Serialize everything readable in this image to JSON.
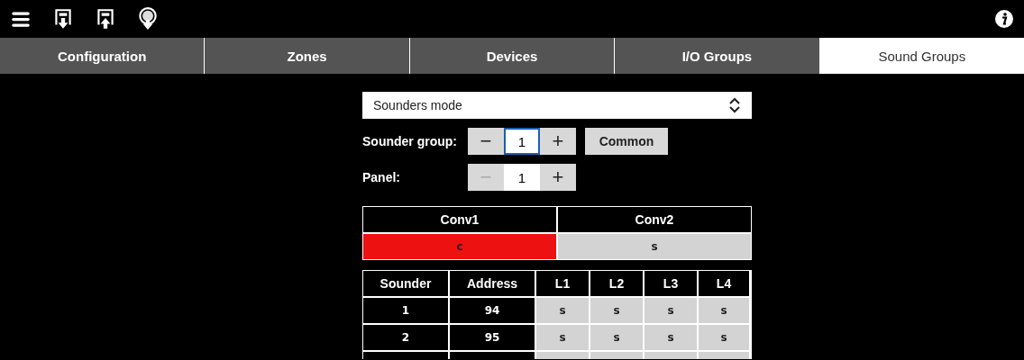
{
  "stepper_symbols": {
    "minus": "−",
    "plus": "+"
  },
  "tabs": [
    {
      "label": "Configuration",
      "selected": false
    },
    {
      "label": "Zones",
      "selected": false
    },
    {
      "label": "Devices",
      "selected": false
    },
    {
      "label": "I/O Groups",
      "selected": false
    },
    {
      "label": "Sound Groups",
      "selected": true
    }
  ],
  "mode_select": {
    "value": "Sounders mode"
  },
  "sounder_group": {
    "label": "Sounder group:",
    "value": "1",
    "focused": true,
    "minus_disabled": false,
    "button": "Common"
  },
  "panel": {
    "label": "Panel:",
    "value": "1",
    "focused": false,
    "minus_disabled": true
  },
  "conv_table": {
    "columns": [
      "Conv1",
      "Conv2"
    ],
    "cells": [
      {
        "text": "c",
        "color": "#ee1111"
      },
      {
        "text": "s",
        "color": "#d3d3d3"
      }
    ]
  },
  "sounder_table": {
    "columns": [
      "Sounder",
      "Address",
      "L1",
      "L2",
      "L3",
      "L4"
    ],
    "rows": [
      {
        "sounder": "1",
        "address": "94",
        "cells": [
          {
            "text": "s",
            "color": "#d3d3d3"
          },
          {
            "text": "s",
            "color": "#d3d3d3"
          },
          {
            "text": "s",
            "color": "#d3d3d3"
          },
          {
            "text": "s",
            "color": "#d3d3d3"
          }
        ]
      },
      {
        "sounder": "2",
        "address": "95",
        "cells": [
          {
            "text": "s",
            "color": "#d3d3d3"
          },
          {
            "text": "s",
            "color": "#d3d3d3"
          },
          {
            "text": "s",
            "color": "#d3d3d3"
          },
          {
            "text": "s",
            "color": "#d3d3d3"
          }
        ]
      },
      {
        "cut_off": true
      }
    ]
  }
}
